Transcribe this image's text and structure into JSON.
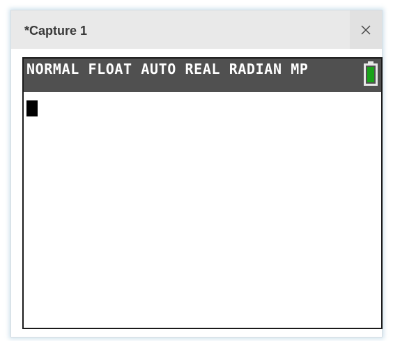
{
  "window": {
    "title": "*Capture 1"
  },
  "calculator": {
    "mode_line": "NORMAL FLOAT AUTO REAL RADIAN MP",
    "battery_icon": "battery-icon",
    "battery_color": "#1aa31a",
    "status_bar_color": "#505050"
  },
  "icons": {
    "close": "close-icon"
  }
}
